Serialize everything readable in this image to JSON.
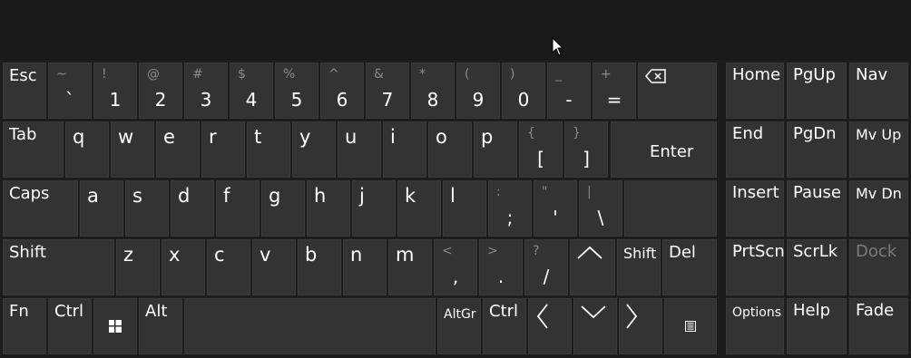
{
  "keyboard": {
    "row1": {
      "esc": "Esc",
      "keys": [
        {
          "s": "~",
          "p": "`"
        },
        {
          "s": "!",
          "p": "1"
        },
        {
          "s": "@",
          "p": "2"
        },
        {
          "s": "#",
          "p": "3"
        },
        {
          "s": "$",
          "p": "4"
        },
        {
          "s": "%",
          "p": "5"
        },
        {
          "s": "^",
          "p": "6"
        },
        {
          "s": "&",
          "p": "7"
        },
        {
          "s": "*",
          "p": "8"
        },
        {
          "s": "(",
          "p": "9"
        },
        {
          "s": ")",
          "p": "0"
        },
        {
          "s": "_",
          "p": "-"
        },
        {
          "s": "+",
          "p": "="
        }
      ]
    },
    "row2": {
      "tab": "Tab",
      "letters": [
        "q",
        "w",
        "e",
        "r",
        "t",
        "y",
        "u",
        "i",
        "o",
        "p"
      ],
      "brackets": [
        {
          "s": "{",
          "p": "["
        },
        {
          "s": "}",
          "p": "]"
        }
      ],
      "enter": "Enter"
    },
    "row3": {
      "caps": "Caps",
      "letters": [
        "a",
        "s",
        "d",
        "f",
        "g",
        "h",
        "j",
        "k",
        "l"
      ],
      "punct": [
        {
          "s": ":",
          "p": ";"
        },
        {
          "s": "\"",
          "p": "'"
        },
        {
          "s": "|",
          "p": "\\"
        }
      ]
    },
    "row4": {
      "shift_left": "Shift",
      "letters": [
        "z",
        "x",
        "c",
        "v",
        "b",
        "n",
        "m"
      ],
      "punct": [
        {
          "s": "<",
          "p": ","
        },
        {
          "s": ">",
          "p": "."
        },
        {
          "s": "?",
          "p": "/"
        }
      ],
      "shift_right": "Shift",
      "del": "Del"
    },
    "row5": {
      "fn": "Fn",
      "ctrl_left": "Ctrl",
      "alt": "Alt",
      "altgr": "AltGr",
      "ctrl_right": "Ctrl"
    }
  },
  "nav_cluster": {
    "keys": [
      [
        "Home",
        "PgUp",
        "Nav"
      ],
      [
        "End",
        "PgDn",
        "Mv Up"
      ],
      [
        "Insert",
        "Pause",
        "Mv Dn"
      ],
      [
        "PrtScn",
        "ScrLk",
        "Dock"
      ],
      [
        "Options",
        "Help",
        "Fade"
      ]
    ]
  },
  "icons": {
    "backspace": "backspace-icon",
    "windows": "windows-logo-icon",
    "menu": "context-menu-icon",
    "cursor": "mouse-pointer-icon"
  }
}
